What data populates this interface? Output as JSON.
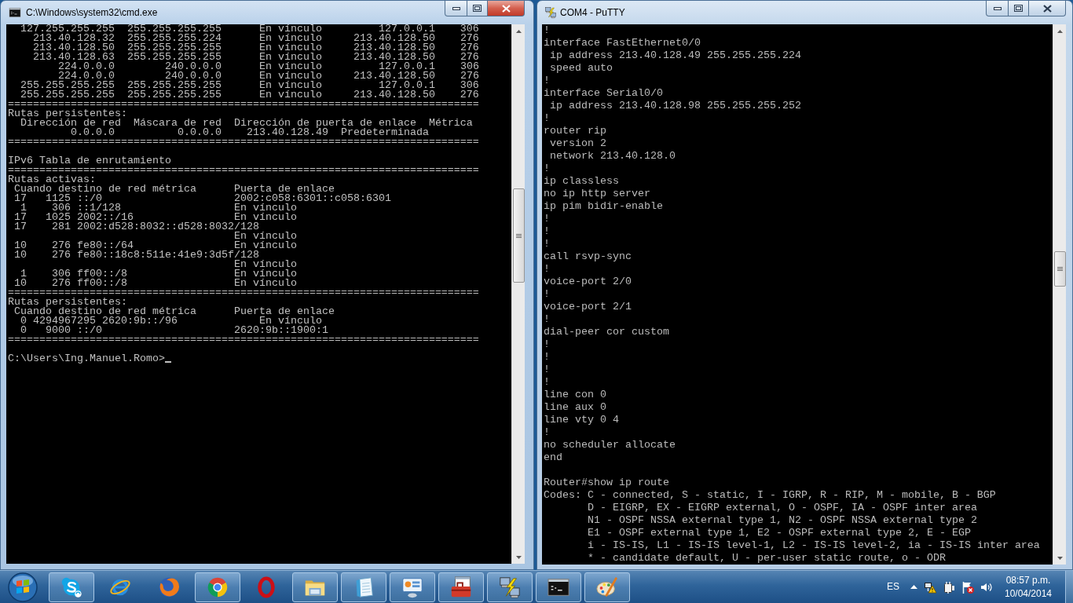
{
  "cmd_window": {
    "title": "C:\\Windows\\system32\\cmd.exe",
    "active": true,
    "output_blocks": [
      [
        "  127.255.255.255  255.255.255.255      En vínculo         127.0.0.1    306",
        "    213.40.128.32  255.255.255.224      En vínculo     213.40.128.50    276",
        "    213.40.128.50  255.255.255.255      En vínculo     213.40.128.50    276",
        "    213.40.128.63  255.255.255.255      En vínculo     213.40.128.50    276",
        "        224.0.0.0        240.0.0.0      En vínculo         127.0.0.1    306",
        "        224.0.0.0        240.0.0.0      En vínculo     213.40.128.50    276",
        "  255.255.255.255  255.255.255.255      En vínculo         127.0.0.1    306",
        "  255.255.255.255  255.255.255.255      En vínculo     213.40.128.50    276",
        "===========================================================================",
        "Rutas persistentes:",
        "  Dirección de red  Máscara de red  Dirección de puerta de enlace  Métrica",
        "          0.0.0.0          0.0.0.0    213.40.128.49  Predeterminada",
        "==========================================================================="
      ],
      [
        "IPv6 Tabla de enrutamiento",
        "===========================================================================",
        "Rutas activas:",
        " Cuando destino de red métrica      Puerta de enlace",
        " 17   1125 ::/0                     2002:c058:6301::c058:6301",
        "  1    306 ::1/128                  En vínculo",
        " 17   1025 2002::/16                En vínculo",
        " 17    281 2002:d528:8032::d528:8032/128",
        "                                    En vínculo",
        " 10    276 fe80::/64                En vínculo",
        " 10    276 fe80::18c8:511e:41e9:3d5f/128",
        "                                    En vínculo",
        "  1    306 ff00::/8                 En vínculo",
        " 10    276 ff00::/8                 En vínculo",
        "===========================================================================",
        "Rutas persistentes:",
        " Cuando destino de red métrica      Puerta de enlace",
        "  0 4294967295 2620:9b::/96             En vínculo",
        "  0   9000 ::/0                     2620:9b::1900:1",
        "==========================================================================="
      ]
    ],
    "prompt": "C:\\Users\\Ing.Manuel.Romo>"
  },
  "putty_window": {
    "title": "COM4 - PuTTY",
    "active": false,
    "output_blocks": [
      [
        "!",
        "interface FastEthernet0/0",
        " ip address 213.40.128.49 255.255.255.224",
        " speed auto",
        "!",
        "interface Serial0/0",
        " ip address 213.40.128.98 255.255.255.252",
        "!",
        "router rip",
        " version 2",
        " network 213.40.128.0",
        "!",
        "ip classless",
        "no ip http server",
        "ip pim bidir-enable",
        "!",
        "!",
        "!",
        "call rsvp-sync",
        "!",
        "voice-port 2/0",
        "!",
        "voice-port 2/1",
        "!",
        "dial-peer cor custom",
        "!",
        "!",
        "!",
        "!",
        "line con 0",
        "line aux 0",
        "line vty 0 4",
        "!",
        "no scheduler allocate",
        "end"
      ],
      [
        "Router#show ip route",
        "Codes: C - connected, S - static, I - IGRP, R - RIP, M - mobile, B - BGP",
        "       D - EIGRP, EX - EIGRP external, O - OSPF, IA - OSPF inter area",
        "       N1 - OSPF NSSA external type 1, N2 - OSPF NSSA external type 2",
        "       E1 - OSPF external type 1, E2 - OSPF external type 2, E - EGP",
        "       i - IS-IS, L1 - IS-IS level-1, L2 - IS-IS level-2, ia - IS-IS inter area",
        "       * - candidate default, U - per-user static route, o - ODR"
      ]
    ]
  },
  "taskbar": {
    "apps": [
      {
        "kind": "skype",
        "running": true
      },
      {
        "kind": "ie",
        "running": false
      },
      {
        "kind": "firefox",
        "running": false
      },
      {
        "kind": "chrome",
        "running": true
      },
      {
        "kind": "opera",
        "running": false
      },
      {
        "kind": "explorer",
        "running": true
      },
      {
        "kind": "notepad",
        "running": true
      },
      {
        "kind": "panel",
        "running": true
      },
      {
        "kind": "toolbox",
        "running": true
      },
      {
        "kind": "putty",
        "running": true
      },
      {
        "kind": "cmd",
        "running": true
      },
      {
        "kind": "paint",
        "running": true
      }
    ],
    "language": "ES",
    "clock": {
      "time": "08:57 p.m.",
      "date": "10/04/2014"
    }
  }
}
